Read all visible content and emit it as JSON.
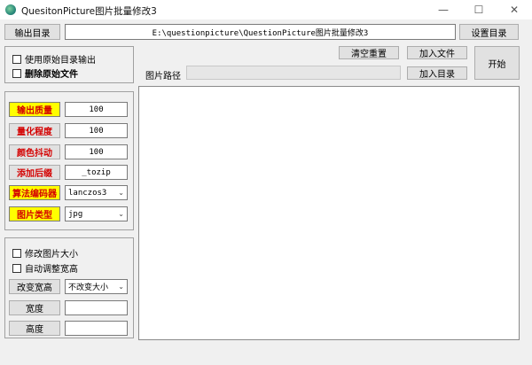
{
  "window": {
    "title": "QuesitonPicture图片批量修改3"
  },
  "toolbar": {
    "output_dir_button": "输出目录",
    "output_path": "E:\\questionpicture\\QuestionPicture图片批量修改3",
    "set_dir_button": "设置目录"
  },
  "options": {
    "use_original_dir": "使用原始目录输出",
    "delete_original": "删除原始文件"
  },
  "params": {
    "quality_label": "输出质量",
    "quality_value": "100",
    "quantize_label": "量化程度",
    "quantize_value": "100",
    "dither_label": "颜色抖动",
    "dither_value": "100",
    "suffix_label": "添加后缀",
    "suffix_value": "_tozip",
    "algorithm_label": "算法编码器",
    "algorithm_value": "lanczos3",
    "type_label": "图片类型",
    "type_value": "jpg"
  },
  "resize": {
    "modify_size": "修改图片大小",
    "auto_adjust": "自动调整宽高",
    "change_button": "改变宽高",
    "change_mode": "不改变大小",
    "width_button": "宽度",
    "height_button": "高度"
  },
  "actions": {
    "clear_reset": "清空重置",
    "add_file": "加入文件",
    "add_dir": "加入目录",
    "start": "开始",
    "path_label": "图片路径"
  }
}
